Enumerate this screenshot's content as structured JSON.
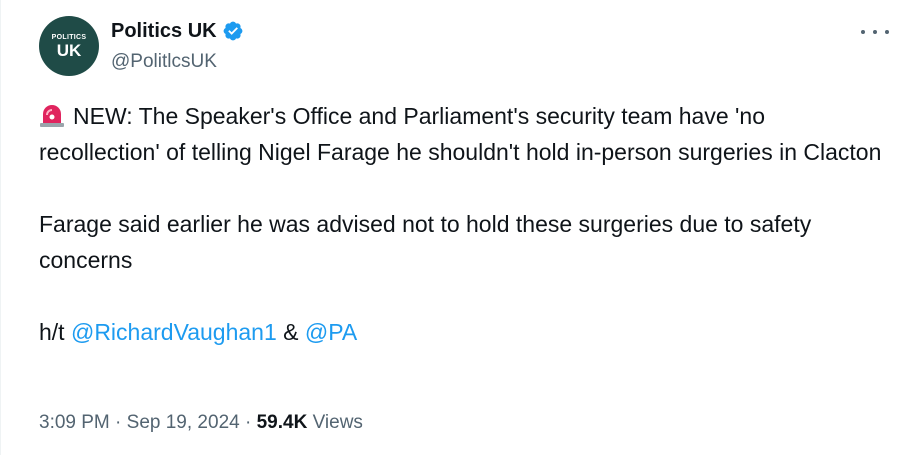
{
  "author": {
    "avatar_text_top": "POLITICS",
    "avatar_text_bottom": "UK",
    "display_name": "Politics UK",
    "handle": "@PolitlcsUK",
    "verified": true
  },
  "tweet": {
    "line1": "NEW: The Speaker's Office and Parliament's security team have 'no recollection' of telling Nigel Farage he shouldn't hold in-person surgeries in Clacton",
    "line2": "Farage said earlier he was advised not to hold these surgeries due to safety concerns",
    "ht_prefix": "h/t",
    "mention1": "@RichardVaughan1",
    "amp": "&",
    "mention2": "@PA"
  },
  "meta": {
    "time": "3:09 PM",
    "sep1": "·",
    "date": "Sep 19, 2024",
    "sep2": "·",
    "views_count": "59.4K",
    "views_label": "Views"
  },
  "icons": {
    "siren": "police-light-icon",
    "verified": "verified-badge-icon",
    "more": "more-options-icon"
  },
  "colors": {
    "text": "#0f1419",
    "secondary": "#536471",
    "link": "#1d9bf0",
    "verified": "#1d9bf0",
    "avatar_bg": "#1f4b47"
  }
}
